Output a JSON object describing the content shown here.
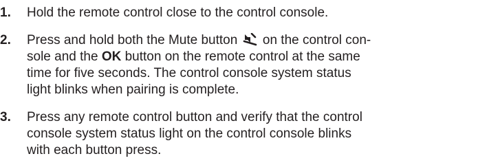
{
  "steps": [
    {
      "number": "1.",
      "text": "Hold the remote control close to the control console."
    },
    {
      "number": "2.",
      "segments": {
        "a": "Press and hold both the Mute button",
        "b": "on the control con-",
        "c": "sole and the",
        "d": "OK",
        "e": "button on the remote control at the same",
        "f": "time for five seconds. The control console system status",
        "g": "light blinks when pairing is complete."
      },
      "icon": "mute-icon"
    },
    {
      "number": "3.",
      "lines": [
        "Press any remote control button and verify that the control",
        "console system status light on the control console blinks",
        "with each button press."
      ]
    }
  ]
}
